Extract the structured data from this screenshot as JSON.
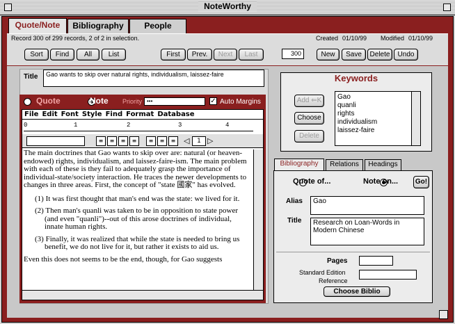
{
  "window": {
    "title": "NoteWorthy"
  },
  "top_tabs": [
    {
      "label": "Quote/Note",
      "active": true
    },
    {
      "label": "Bibliography",
      "active": false
    },
    {
      "label": "People",
      "active": false
    }
  ],
  "record_info": "Record 300 of 299 records, 2 of 2 in selection.",
  "created": {
    "label": "Created",
    "value": "01/10/99"
  },
  "modified": {
    "label": "Modified",
    "value": "01/10/99"
  },
  "nav_buttons": {
    "sort": "Sort",
    "find": "Find",
    "all": "All",
    "list": "List",
    "first": "First",
    "prev": "Prev.",
    "next": "Next",
    "last": "Last"
  },
  "record_number": "300",
  "action_buttons": {
    "new": "New",
    "save": "Save",
    "delete": "Delete",
    "undo": "Undo"
  },
  "title_field": {
    "label": "Title",
    "value": "Gao wants to skip over natural rights, individualism, laissez-faire"
  },
  "type_radio": {
    "quote": "Quote",
    "note": "Note",
    "selected": "note"
  },
  "priority": {
    "label": "Priority",
    "value": "•••"
  },
  "auto_margins": {
    "label": "Auto Margins",
    "checked": true
  },
  "editor_menu": [
    "File",
    "Edit",
    "Font",
    "Style",
    "Find",
    "Format",
    "Database"
  ],
  "ruler_marks": [
    "0",
    "1",
    "2",
    "3",
    "4"
  ],
  "page_number": "1",
  "doc": {
    "para1": "The main doctrines that Gao wants to skip over are: natural (or heaven-endowed) rights, individualism, and laissez-faire-ism. The main problem with each of these is they fail to adequately grasp the importance of individual-state/society interaction. He traces the newer developments to changes in three areas. First, the concept of \"state 國家\" has evolved.",
    "item1": "(1) It was first thought that man's end was the state: we lived for it.",
    "item2": "(2) Then man's quanli was taken to be in opposition to state power (and even \"quanli\")--out of this arose doctrines of individual, innate human rights.",
    "item3": "(3) Finally, it was realized that while the state is needed to bring us benefit, we do not live for it, but rather it exists to aid us.",
    "para2": "Even this does not seems to be the end, though, for Gao suggests"
  },
  "keywords": {
    "title": "Keywords",
    "add_button": "Add ⇐K",
    "choose_button": "Choose",
    "delete_button": "Delete",
    "items": [
      "Gao",
      "quanli",
      "rights",
      "individualism",
      "laissez-faire"
    ]
  },
  "sub_tabs": [
    {
      "label": "Bibliography",
      "active": true
    },
    {
      "label": "Relations",
      "active": false
    },
    {
      "label": "Headings",
      "active": false
    }
  ],
  "bib": {
    "quote_of": "Quote of...",
    "note_on": "Note on...",
    "selected": "note_on",
    "go_button": "Go!",
    "alias_label": "Alias",
    "alias_value": "Gao",
    "title_label": "Title",
    "title_value": "Research on Loan-Words in Modern Chinese",
    "pages_label": "Pages",
    "pages_value": "",
    "std_ref_label_1": "Standard Edition",
    "std_ref_label_2": "Reference",
    "std_ref_value": "",
    "choose_biblio": "Choose Biblio"
  },
  "colors": {
    "frame": "#8a1f1f",
    "panel": "#dcdcdc"
  }
}
